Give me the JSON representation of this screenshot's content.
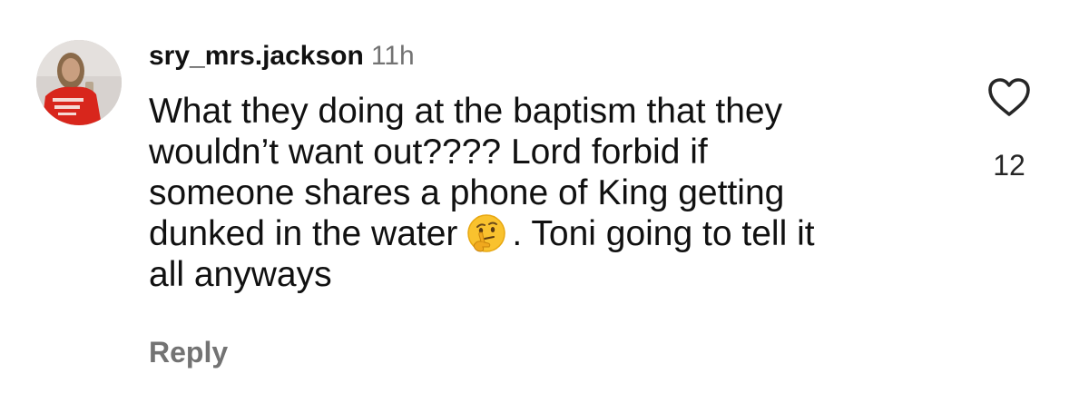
{
  "comment": {
    "username": "sry_mrs.jackson",
    "time": "11h",
    "text_lines": [
      "What they doing at the baptism that they",
      "wouldn’t want out???? Lord forbid if",
      "someone shares a phone of King getting",
      "dunked in the water",
      ". Toni going to tell it",
      "all anyways"
    ],
    "emoji": "thinking-face-emoji",
    "reply_label": "Reply",
    "like_count": "12",
    "like_icon": "heart-outline-icon"
  }
}
